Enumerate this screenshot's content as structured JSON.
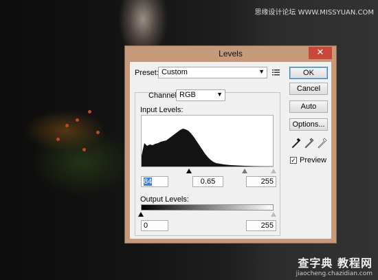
{
  "watermark_top": "思缘设计论坛 WWW.MISSYUAN.COM",
  "watermark_bottom": {
    "brand": "查字典 教程网",
    "url": "jiaocheng.chazidian.com"
  },
  "dialog": {
    "title": "Levels",
    "close_glyph": "✕",
    "preset": {
      "label": "Preset:",
      "value": "Custom",
      "menu_icon": "preset-menu-icon"
    },
    "channel": {
      "label": "Channel:",
      "value": "RGB"
    },
    "input_levels": {
      "label": "Input Levels:",
      "black": "84",
      "gamma": "0.65",
      "white": "255"
    },
    "output_levels": {
      "label": "Output Levels:",
      "black": "0",
      "white": "255"
    },
    "buttons": {
      "ok": "OK",
      "cancel": "Cancel",
      "auto": "Auto",
      "options": "Options..."
    },
    "eyedroppers": [
      "black-point-eyedropper-icon",
      "gray-point-eyedropper-icon",
      "white-point-eyedropper-icon"
    ],
    "preview": {
      "label": "Preview",
      "checked": true
    },
    "colors": {
      "title_bar": "#c6997b",
      "close_button": "#c9483c",
      "client": "#f0f0f0"
    }
  }
}
